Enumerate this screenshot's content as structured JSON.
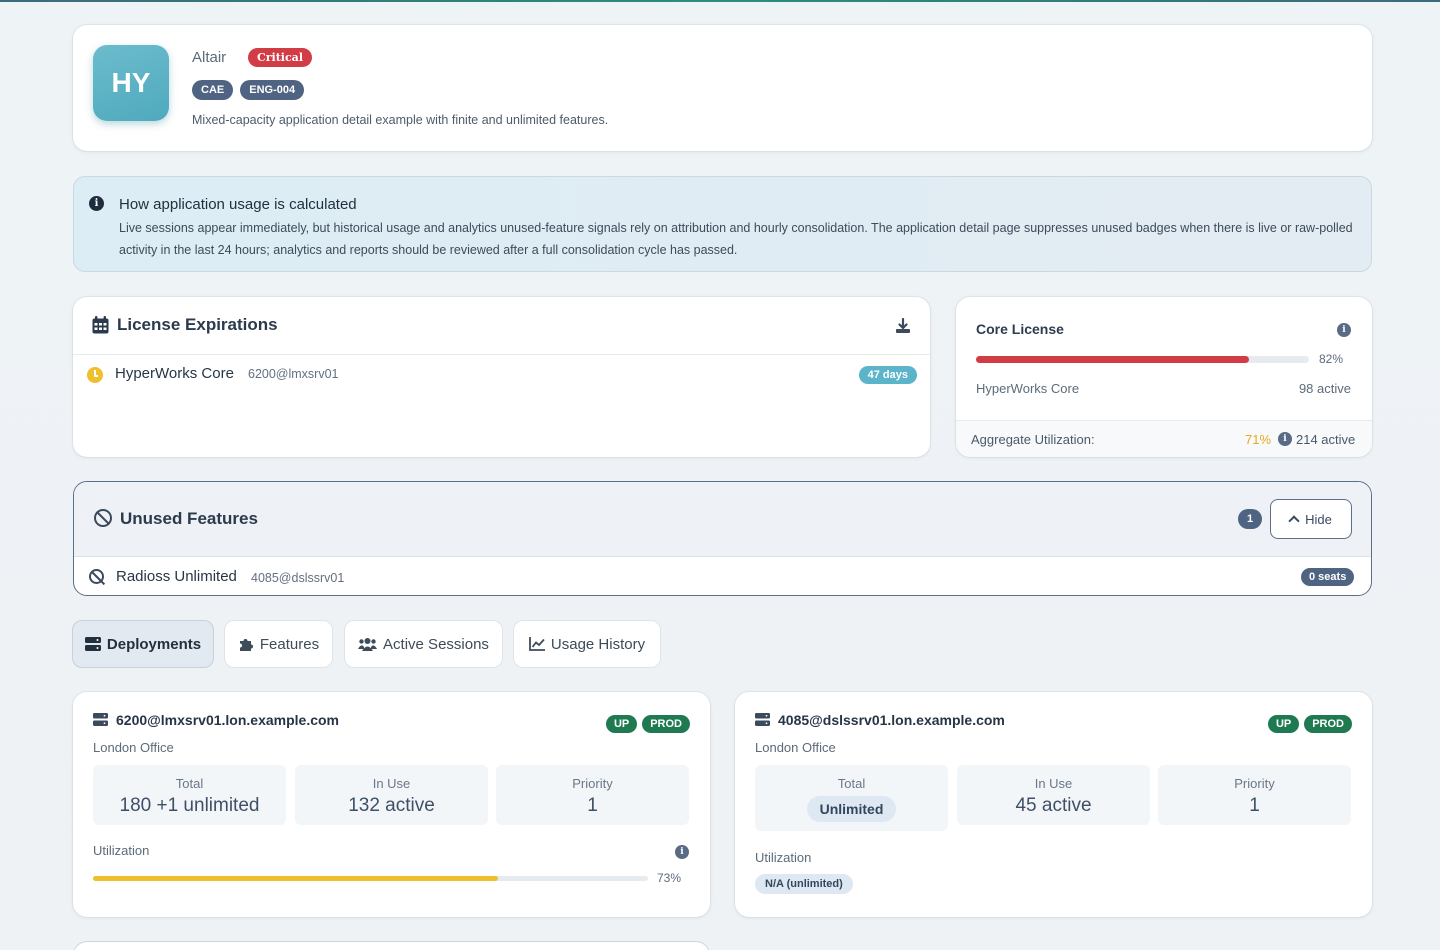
{
  "header": {
    "avatar_initials": "HY",
    "vendor": "Altair",
    "severity": "Critical",
    "tags": [
      "CAE",
      "ENG-004"
    ],
    "description": "Mixed-capacity application detail example with finite and unlimited features."
  },
  "info_banner": {
    "title": "How application usage is calculated",
    "body": "Live sessions appear immediately, but historical usage and analytics unused-feature signals rely on attribution and hourly consolidation. The application detail page suppresses unused badges when there is live or raw-polled activity in the last 24 hours; analytics and reports should be reviewed after a full consolidation cycle has passed."
  },
  "license_expirations": {
    "title": "License Expirations",
    "items": [
      {
        "name": "HyperWorks Core",
        "host": "6200@lmxsrv01",
        "remaining": "47 days"
      }
    ]
  },
  "core_license": {
    "title": "Core License",
    "utilization_pct": 82,
    "utilization_label": "82%",
    "feature": "HyperWorks Core",
    "active": "98 active",
    "aggregate_label": "Aggregate Utilization:",
    "aggregate_pct": "71%",
    "aggregate_active": "214 active",
    "bar_color": "#d23d45"
  },
  "unused_features": {
    "title": "Unused Features",
    "count": "1",
    "toggle_label": "Hide",
    "items": [
      {
        "name": "Radioss Unlimited",
        "host": "4085@dslssrv01",
        "seats": "0 seats"
      }
    ]
  },
  "tabs": [
    {
      "label": "Deployments",
      "icon": "server-icon",
      "active": true
    },
    {
      "label": "Features",
      "icon": "puzzle-icon",
      "active": false
    },
    {
      "label": "Active Sessions",
      "icon": "users-icon",
      "active": false
    },
    {
      "label": "Usage History",
      "icon": "chart-line-icon",
      "active": false
    }
  ],
  "deployments": [
    {
      "host": "6200@lmxsrv01.lon.example.com",
      "status": "UP",
      "env": "PROD",
      "location": "London Office",
      "total_label": "Total",
      "total_value": "180 +1 unlimited",
      "in_use_label": "In Use",
      "in_use_value": "132 active",
      "priority_label": "Priority",
      "priority_value": "1",
      "utilization_label": "Utilization",
      "utilization_pct": 73,
      "utilization_text": "73%"
    },
    {
      "host": "4085@dslssrv01.lon.example.com",
      "status": "UP",
      "env": "PROD",
      "location": "London Office",
      "total_label": "Total",
      "total_value": "Unlimited",
      "in_use_label": "In Use",
      "in_use_value": "45 active",
      "priority_label": "Priority",
      "priority_value": "1",
      "utilization_label": "Utilization",
      "utilization_text": "N/A (unlimited)"
    }
  ],
  "colors": {
    "critical": "#d23d45",
    "warning": "#f0bf2d",
    "status_up": "#1f7a52",
    "accent": "#5bb4c9",
    "badge_dark": "#4f6483"
  }
}
